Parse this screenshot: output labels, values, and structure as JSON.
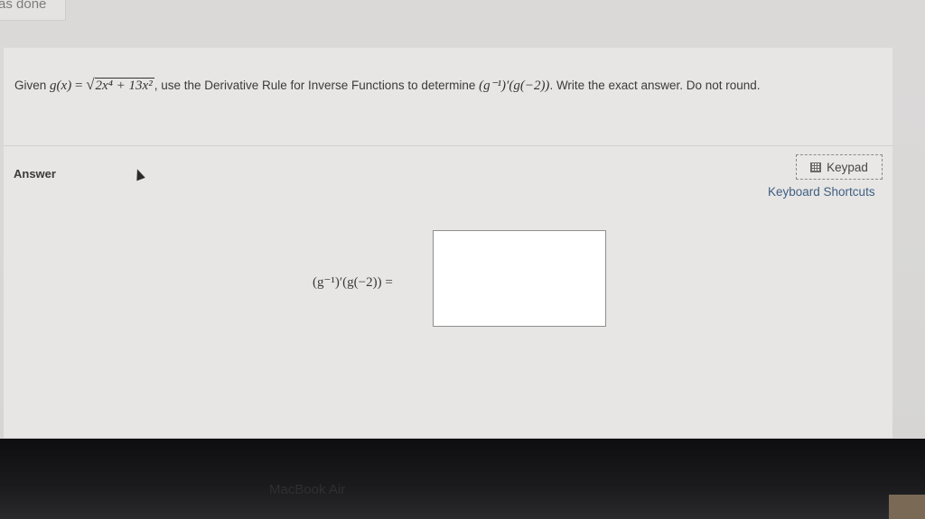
{
  "top_label": "as done",
  "question": {
    "given_word": "Given",
    "lhs": "g(x)",
    "equals": "=",
    "sqrt_content": "2x⁴ + 13x²",
    "sentence_mid": ", use the Derivative Rule for Inverse Functions to determine",
    "target_expr": "(g⁻¹)′(g(−2))",
    "sentence_end": ". Write the exact answer. Do not round."
  },
  "answer": {
    "label": "Answer",
    "keypad_label": "Keypad",
    "shortcuts_label": "Keyboard Shortcuts",
    "expression": "(g⁻¹)′(g(−2)) =",
    "input_value": ""
  },
  "bezel": {
    "brand": "MacBook Air"
  }
}
